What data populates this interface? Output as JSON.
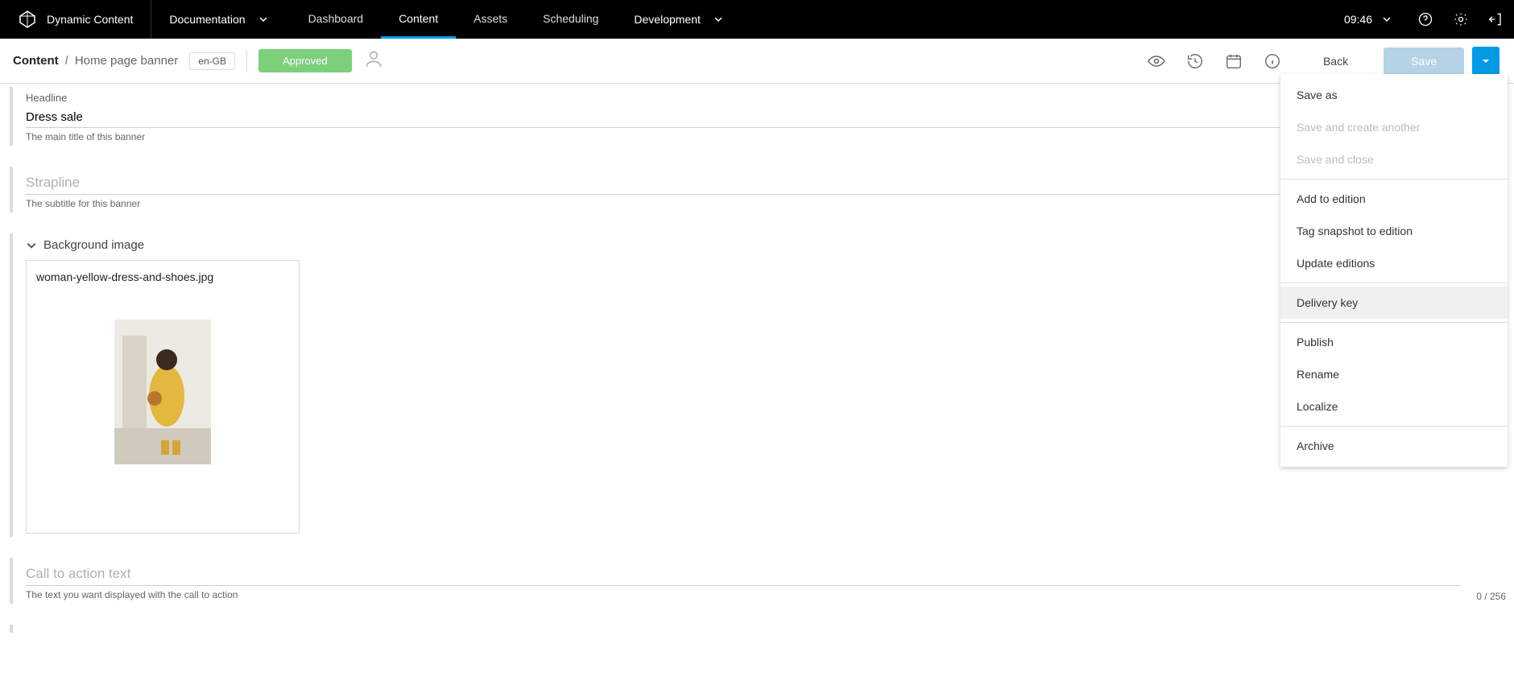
{
  "topbar": {
    "brand": "Dynamic Content",
    "docspace": "Documentation",
    "nav": {
      "dashboard": "Dashboard",
      "content": "Content",
      "assets": "Assets",
      "scheduling": "Scheduling",
      "active": "content"
    },
    "development": "Development",
    "clock": "09:46"
  },
  "subheader": {
    "crumb_root": "Content",
    "crumb_leaf": "Home page banner",
    "locale": "en-GB",
    "status": "Approved",
    "back_label": "Back",
    "save_label": "Save"
  },
  "dropdown": {
    "save_as": "Save as",
    "save_and_create": "Save and create another",
    "save_and_close": "Save and close",
    "add_to_edition": "Add to edition",
    "tag_snapshot": "Tag snapshot to edition",
    "update_editions": "Update editions",
    "delivery_key": "Delivery key",
    "publish": "Publish",
    "rename": "Rename",
    "localize": "Localize",
    "archive": "Archive"
  },
  "form": {
    "headline_label": "Headline",
    "headline_value": "Dress sale",
    "headline_help": "The main title of this banner",
    "strapline_label": "Strapline",
    "strapline_placeholder": "Strapline",
    "strapline_help": "The subtitle for this banner",
    "bg_image_label": "Background image",
    "bg_image_filename": "woman-yellow-dress-and-shoes.jpg",
    "cta_label": "Call to action text",
    "cta_placeholder": "Call to action text",
    "cta_help": "The text you want displayed with the call to action",
    "cta_counter": "0 / 256"
  }
}
